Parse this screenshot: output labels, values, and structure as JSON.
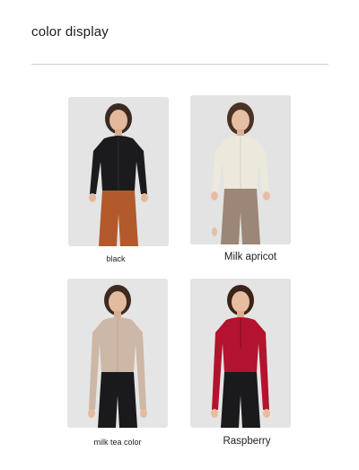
{
  "heading": "color display",
  "variants": [
    {
      "label": "black",
      "top_color": "#1b1b1d",
      "bottom_color": "#b35a2c"
    },
    {
      "label": "Milk apricot",
      "top_color": "#ece8dc",
      "bottom_color": "#9c8677"
    },
    {
      "label": "milk tea color",
      "top_color": "#cdb7a6",
      "bottom_color": "#1a1a1c"
    },
    {
      "label": "Raspberry",
      "top_color": "#b3132f",
      "bottom_color": "#1a1a1c"
    }
  ]
}
